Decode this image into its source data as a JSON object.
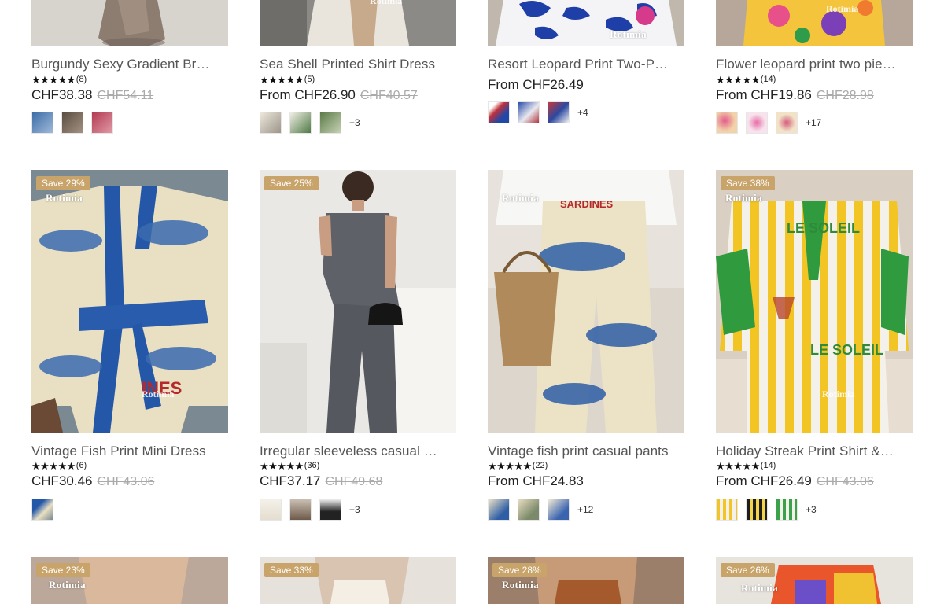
{
  "brand_watermark": "Rotimia",
  "products": [
    {
      "title": "Burgundy Sexy Gradient Br…",
      "rating_count": "(8)",
      "stars": "★★★★★",
      "price": "CHF38.38",
      "original_price": "CHF54.11",
      "swatch_more": "",
      "save": ""
    },
    {
      "title": "Sea Shell Printed Shirt Dress",
      "rating_count": "(5)",
      "stars": "★★★★★",
      "price": "From CHF26.90",
      "original_price": "CHF40.57",
      "swatch_more": "+3",
      "save": ""
    },
    {
      "title": "Resort Leopard Print Two-P…",
      "rating_count": "",
      "stars": "",
      "price": "From CHF26.49",
      "original_price": "",
      "swatch_more": "+4",
      "save": ""
    },
    {
      "title": "Flower leopard print two pie…",
      "rating_count": "(14)",
      "stars": "★★★★★",
      "price": "From CHF19.86",
      "original_price": "CHF28.98",
      "swatch_more": "+17",
      "save": ""
    },
    {
      "title": "Vintage Fish Print Mini Dress",
      "rating_count": "(6)",
      "stars": "★★★★★",
      "price": "CHF30.46",
      "original_price": "CHF43.06",
      "swatch_more": "",
      "save": "Save 29%"
    },
    {
      "title": "Irregular sleeveless casual …",
      "rating_count": "(36)",
      "stars": "★★★★★",
      "price": "CHF37.17",
      "original_price": "CHF49.68",
      "swatch_more": "+3",
      "save": "Save 25%"
    },
    {
      "title": "Vintage fish print casual pants",
      "rating_count": "(22)",
      "stars": "★★★★★",
      "price": "From CHF24.83",
      "original_price": "",
      "swatch_more": "+12",
      "save": ""
    },
    {
      "title": "Holiday Streak Print Shirt &…",
      "rating_count": "(14)",
      "stars": "★★★★★",
      "price": "From CHF26.49",
      "original_price": "CHF43.06",
      "swatch_more": "+3",
      "save": "Save 38%"
    },
    {
      "save": "Save 23%"
    },
    {
      "save": "Save 33%"
    },
    {
      "save": "Save 28%"
    },
    {
      "save": "Save 26%"
    }
  ],
  "print_text": {
    "fish_label": "INES",
    "sardines_label": "SARDINES",
    "le_soleil_1": "LE SOLEIL",
    "le_soleil_2": "LE SOLEIL"
  },
  "colors": {
    "save_badge": "#c8a36a",
    "price": "#222222",
    "original_price": "#aaaaaa",
    "title": "#555555"
  }
}
